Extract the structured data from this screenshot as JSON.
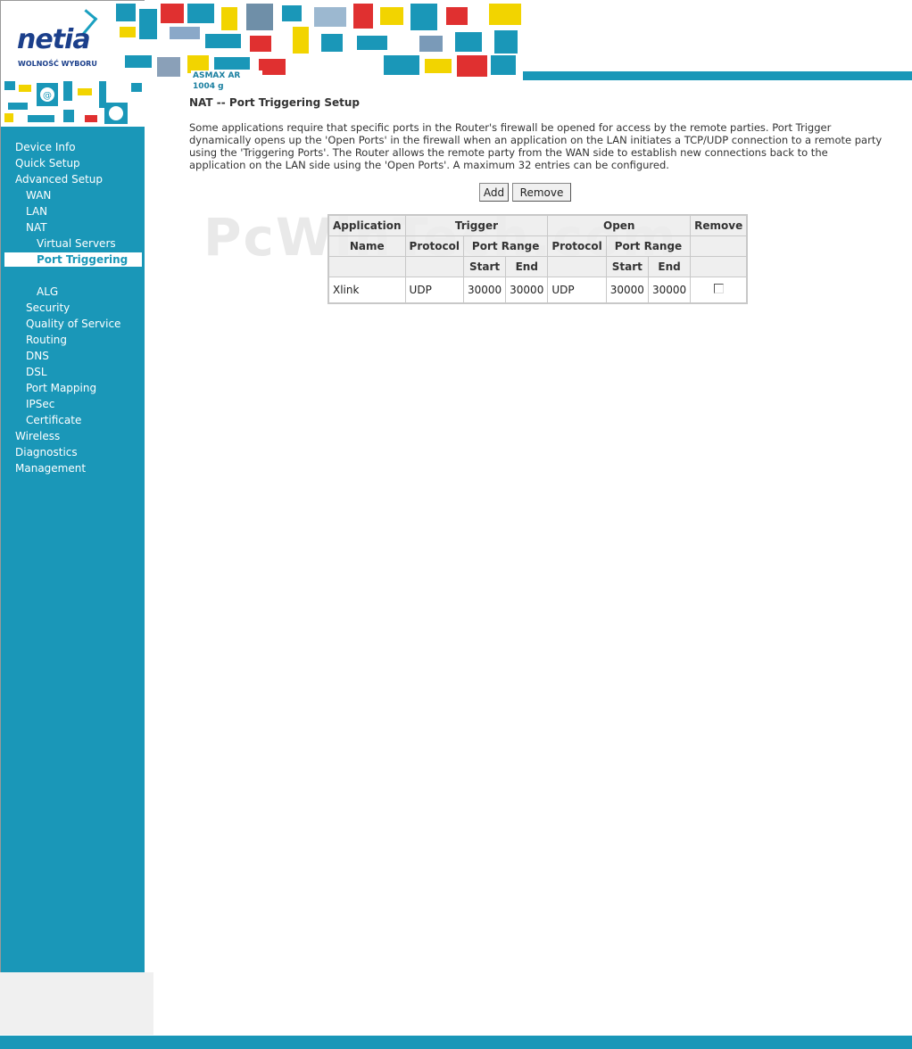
{
  "header": {
    "brand": "netia",
    "tagline": "WOLNOŚĆ WYBORU",
    "model": "ASMAX AR 1004 g"
  },
  "sidebar": {
    "items": [
      {
        "label": "Device Info"
      },
      {
        "label": "Quick Setup"
      },
      {
        "label": "Advanced Setup"
      },
      {
        "label": "WAN"
      },
      {
        "label": "LAN"
      },
      {
        "label": "NAT"
      },
      {
        "label": "Virtual Servers"
      },
      {
        "label": "Port Triggering"
      },
      {
        "label": "ALG"
      },
      {
        "label": "Security"
      },
      {
        "label": "Quality of Service"
      },
      {
        "label": "Routing"
      },
      {
        "label": "DNS"
      },
      {
        "label": "DSL"
      },
      {
        "label": "Port Mapping"
      },
      {
        "label": "IPSec"
      },
      {
        "label": "Certificate"
      },
      {
        "label": "Wireless"
      },
      {
        "label": "Diagnostics"
      },
      {
        "label": "Management"
      }
    ],
    "active": "Port Triggering"
  },
  "main": {
    "title": "NAT -- Port Triggering Setup",
    "description": "Some applications require that specific ports in the Router's firewall be opened for access by the remote parties. Port Trigger dynamically opens up the 'Open Ports' in the firewall when an application on the LAN initiates a TCP/UDP connection to a remote party using the 'Triggering Ports'. The Router allows the remote party from the WAN side to establish new connections back to the application on the LAN side using the 'Open Ports'. A maximum 32 entries can be configured.",
    "add_label": "Add",
    "remove_label": "Remove",
    "watermark": "PcWinTech.com"
  },
  "table": {
    "h_application": "Application",
    "h_trigger": "Trigger",
    "h_open": "Open",
    "h_remove": "Remove",
    "h_name": "Name",
    "h_protocol": "Protocol",
    "h_port_range": "Port Range",
    "h_start": "Start",
    "h_end": "End",
    "rows": [
      {
        "name": "Xlink",
        "trigger_protocol": "UDP",
        "trigger_start": "30000",
        "trigger_end": "30000",
        "open_protocol": "UDP",
        "open_start": "30000",
        "open_end": "30000",
        "remove_checked": false
      }
    ]
  },
  "colors": {
    "accent": "#1a97b8",
    "brand": "#1b3f8b"
  }
}
